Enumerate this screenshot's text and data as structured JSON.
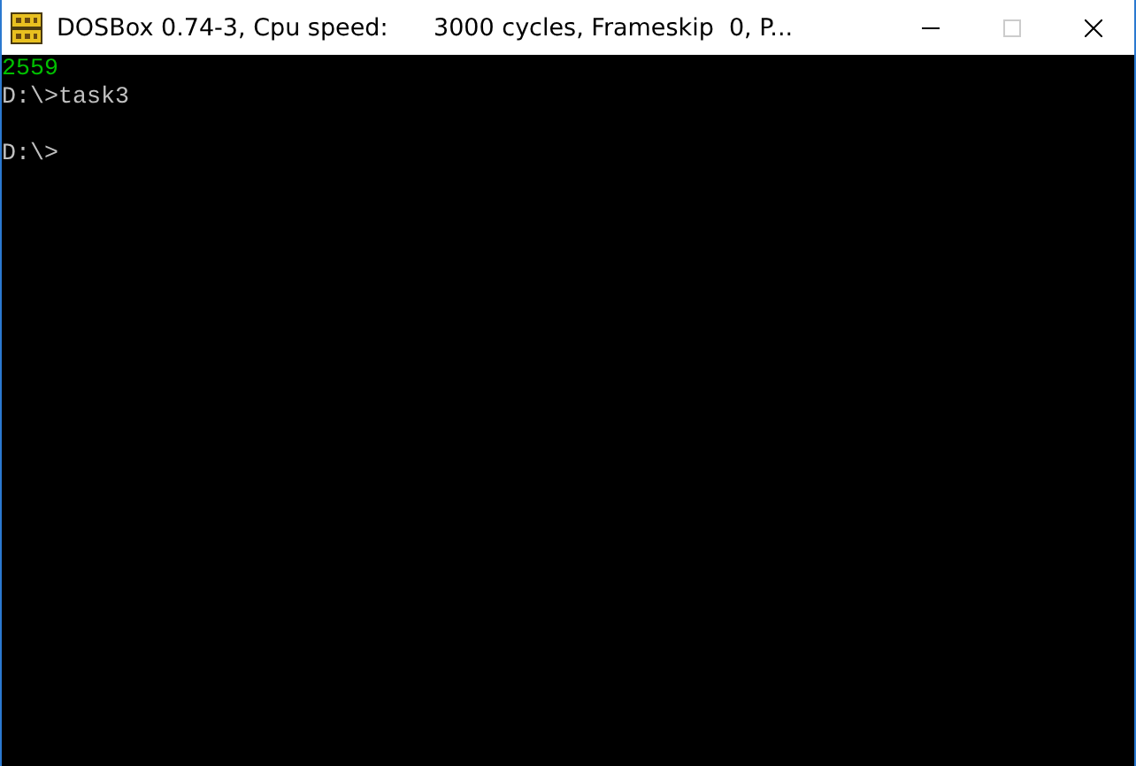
{
  "window": {
    "title": "DOSBox 0.74-3, Cpu speed:      3000 cycles, Frameskip  0, P..."
  },
  "console": {
    "lines": [
      {
        "kind": "text",
        "text": "2559",
        "color": "#00c000"
      },
      {
        "kind": "text",
        "text": "D:\\>task3",
        "color": "#c0c0c0"
      },
      {
        "kind": "blank"
      },
      {
        "kind": "text",
        "text": "D:\\>",
        "color": "#c0c0c0"
      }
    ]
  }
}
